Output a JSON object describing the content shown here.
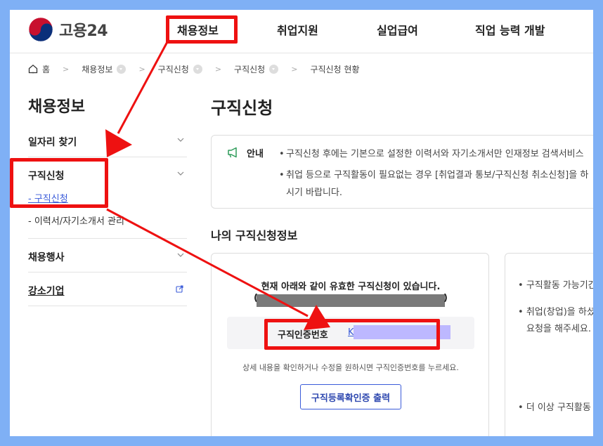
{
  "header": {
    "logo_text": "고용24",
    "nav": [
      "채용정보",
      "취업지원",
      "실업급여",
      "직업 능력 개발"
    ]
  },
  "breadcrumb": [
    "홈",
    "채용정보",
    "구직신청",
    "구직신청",
    "구직신청 현황"
  ],
  "sidebar": {
    "title": "채용정보",
    "items": [
      {
        "label": "일자리 찾기"
      },
      {
        "label": "구직신청",
        "subs": [
          "- 구직신청",
          "- 이력서/자기소개서 관리"
        ]
      },
      {
        "label": "채용행사"
      },
      {
        "label": "강소기업"
      }
    ]
  },
  "main": {
    "title": "구직신청",
    "notice": {
      "label": "안내",
      "line1": "구직신청 후에는 기본으로 설정한 이력서와 자기소개서만 인재정보 검색서비스",
      "line2": "취업 등으로 구직활동이 필요없는 경우 [취업결과 통보/구직신청 취소신청]을 하",
      "line3": "시기 바랍니다."
    },
    "section_title": "나의 구직신청정보",
    "card": {
      "message": "현재 아래와 같이 유효한 구직신청이 있습니다.",
      "paren_open": "(",
      "paren_close": ")",
      "cert_label": "구직인증번호",
      "cert_value": "K",
      "help": "상세 내용을 확인하거나 수정을 원하시면 구직인증번호를 누르세요.",
      "print_button": "구직등록확인증 출력"
    },
    "card2": {
      "line1": "구직활동 가능기간",
      "line2": "취업(창업)을 하셨",
      "line3": "요청을 해주세요.",
      "line4": "더 이상 구직활동"
    }
  },
  "colors": {
    "accent": "#3a5bd9",
    "annotation": "#ee1111",
    "backdrop": "#7fb0f5"
  }
}
